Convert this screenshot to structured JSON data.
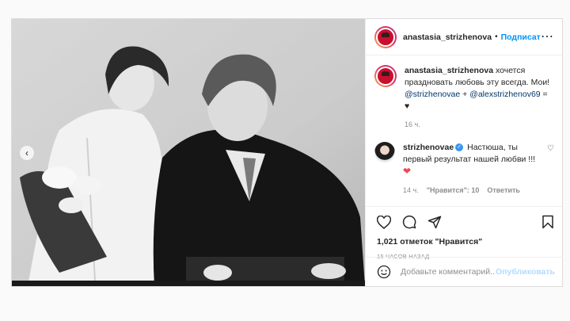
{
  "post": {
    "author": "anastasia_strizhenova",
    "dot": "•",
    "follow_label": "Подписат",
    "more_icon": "⋯",
    "caption": {
      "author": "anastasia_strizhenova",
      "text_before": "хочется праздновать любовь эту всегда. Мои! ",
      "mention1": "@strizhenovae",
      "plus": " + ",
      "mention2": "@alexstrizhenov69",
      "suffix": " = ♥",
      "time": "16 ч."
    },
    "comment": {
      "author": "strizhenovae",
      "text": "Настюша, ты первый результат нашей любви !!!",
      "heart": "❤",
      "time": "14 ч.",
      "likes": "\"Нравится\": 10",
      "reply": "Ответить"
    },
    "likes_text": "1,021 отметок \"Нравится\"",
    "posted_ago": "16 ЧАСОВ НАЗАД",
    "comment_placeholder": "Добавьте комментарий...",
    "publish_label": "Опубликовать",
    "prev_arrow": "‹"
  },
  "colors": {
    "accent": "#0095f6",
    "mention": "#00376b",
    "heart": "#ed4956",
    "muted": "#8e8e8e"
  },
  "icons": [
    "heart-icon",
    "comment-icon",
    "share-icon",
    "bookmark-icon",
    "smile-icon",
    "verified-icon",
    "chevron-left-icon",
    "more-icon"
  ]
}
